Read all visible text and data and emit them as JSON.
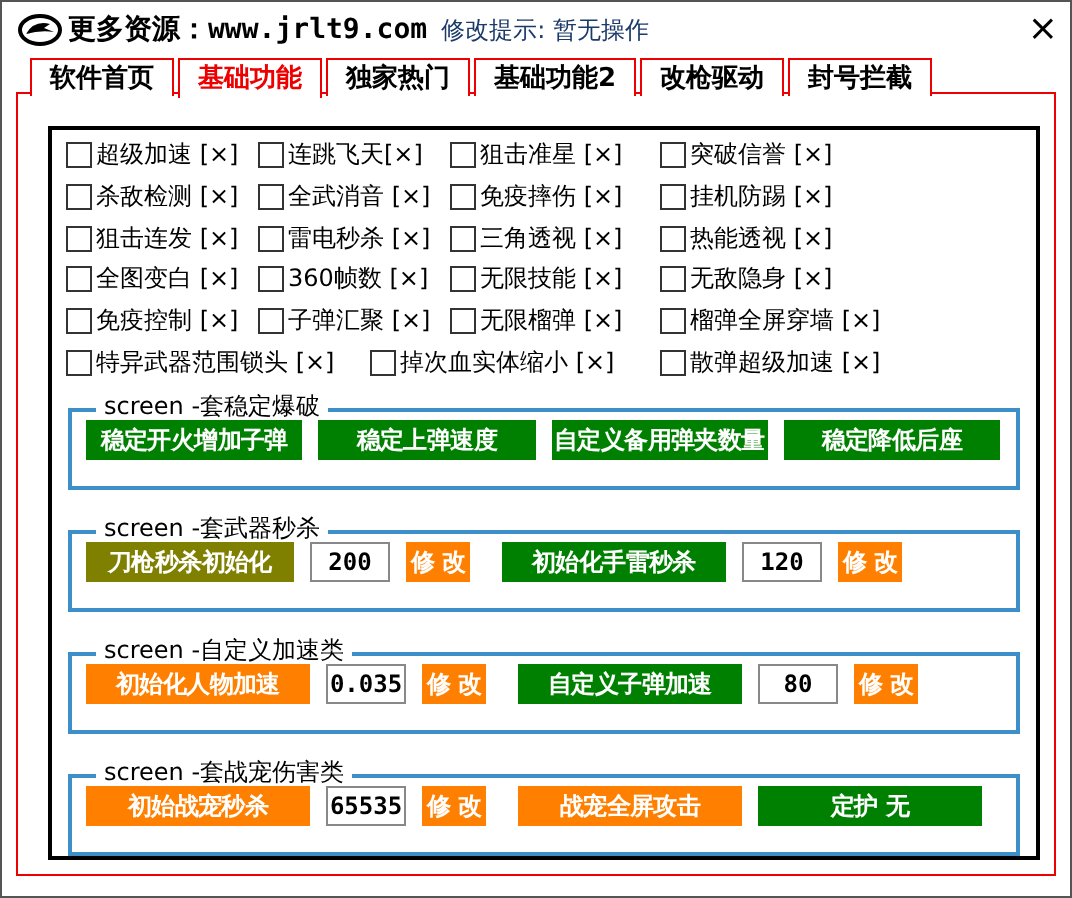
{
  "window": {
    "title": "更多资源：www.jrlt9.com",
    "hint": "修改提示: 暂无操作",
    "close": "×"
  },
  "tabs": [
    {
      "label": "软件首页",
      "selected": false
    },
    {
      "label": "基础功能",
      "selected": true
    },
    {
      "label": "独家热门",
      "selected": false
    },
    {
      "label": "基础功能2",
      "selected": false
    },
    {
      "label": "改枪驱动",
      "selected": false
    },
    {
      "label": "封号拦截",
      "selected": false
    }
  ],
  "options": [
    [
      {
        "label": "超级加速 [×]",
        "checked": false
      },
      {
        "label": "连跳飞天[×]",
        "checked": false
      },
      {
        "label": "狙击准星 [×]",
        "checked": false
      },
      {
        "label": "突破信誉 [×]",
        "checked": false
      }
    ],
    [
      {
        "label": "杀敌检测 [×]",
        "checked": false
      },
      {
        "label": "全武消音 [×]",
        "checked": false
      },
      {
        "label": "免疫摔伤 [×]",
        "checked": false
      },
      {
        "label": "挂机防踢 [×]",
        "checked": false
      }
    ],
    [
      {
        "label": "狙击连发 [×]",
        "checked": false
      },
      {
        "label": "雷电秒杀 [×]",
        "checked": false
      },
      {
        "label": "三角透视 [×]",
        "checked": false
      },
      {
        "label": "热能透视 [×]",
        "checked": false
      }
    ],
    [
      {
        "label": "全图变白 [×]",
        "checked": false
      },
      {
        "label": "360帧数 [×]",
        "checked": false
      },
      {
        "label": "无限技能 [×]",
        "checked": false
      },
      {
        "label": "无敌隐身 [×]",
        "checked": false
      }
    ],
    [
      {
        "label": "免疫控制 [×]",
        "checked": false
      },
      {
        "label": "子弹汇聚 [×]",
        "checked": false
      },
      {
        "label": "无限榴弹 [×]",
        "checked": false
      },
      {
        "label": "榴弹全屏穿墙 [×]",
        "checked": false
      }
    ],
    [
      {
        "label": "特异武器范围锁头 [×]",
        "checked": false
      },
      {
        "label": "掉次血实体缩小 [×]",
        "checked": false
      },
      {
        "label": "散弹超级加速 [×]",
        "checked": false
      }
    ]
  ],
  "groups": [
    {
      "legend": "screen -套稳定爆破",
      "items": [
        {
          "kind": "button",
          "label": "稳定开火增加子弹",
          "color": "#008000"
        },
        {
          "kind": "button",
          "label": "稳定上弹速度",
          "color": "#008000"
        },
        {
          "kind": "button",
          "label": "自定义备用弹夹数量",
          "color": "#008000"
        },
        {
          "kind": "button",
          "label": "稳定降低后座",
          "color": "#008000"
        }
      ]
    },
    {
      "legend": "screen -套武器秒杀",
      "items": [
        {
          "kind": "button",
          "label": "刀枪秒杀初始化",
          "color": "#808000"
        },
        {
          "kind": "field",
          "value": "200"
        },
        {
          "kind": "small",
          "label": "修 改",
          "color": "#ff8000"
        },
        {
          "kind": "button",
          "label": "初始化手雷秒杀",
          "color": "#008000"
        },
        {
          "kind": "field",
          "value": "120"
        },
        {
          "kind": "small",
          "label": "修 改",
          "color": "#ff8000"
        }
      ]
    },
    {
      "legend": "screen -自定义加速类",
      "items": [
        {
          "kind": "button",
          "label": "初始化人物加速",
          "color": "#ff8000"
        },
        {
          "kind": "field",
          "value": "0.035"
        },
        {
          "kind": "small",
          "label": "修 改",
          "color": "#ff8000"
        },
        {
          "kind": "button",
          "label": "自定义子弹加速",
          "color": "#008000"
        },
        {
          "kind": "field",
          "value": "80"
        },
        {
          "kind": "small",
          "label": "修 改",
          "color": "#ff8000"
        }
      ]
    },
    {
      "legend": "screen -套战宠伤害类",
      "items": [
        {
          "kind": "button",
          "label": "初始战宠秒杀",
          "color": "#ff8000"
        },
        {
          "kind": "field",
          "value": "65535"
        },
        {
          "kind": "small",
          "label": "修 改",
          "color": "#ff8000"
        },
        {
          "kind": "button",
          "label": "战宠全屏攻击",
          "color": "#ff8000"
        },
        {
          "kind": "button",
          "label": "定护 无",
          "color": "#008000"
        }
      ]
    }
  ]
}
